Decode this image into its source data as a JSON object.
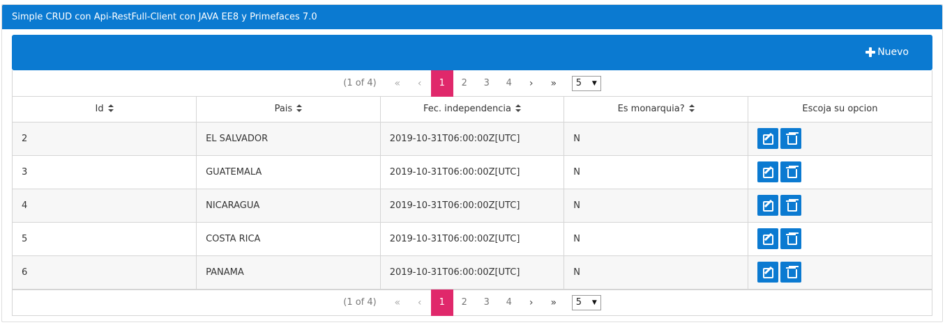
{
  "panel": {
    "title": "Simple CRUD con Api-RestFull-Client con JAVA EE8 y Primefaces 7.0"
  },
  "toolbar": {
    "new_label": "Nuevo"
  },
  "paginator": {
    "current_report": "(1 of 4)",
    "first": "«",
    "prev": "‹",
    "pages": [
      "1",
      "2",
      "3",
      "4"
    ],
    "selected_page": "1",
    "next": "›",
    "last": "»",
    "rows_per_page": "5"
  },
  "table": {
    "columns": [
      "Id",
      "Pais",
      "Fec. independencia",
      "Es monarquia?",
      "Escoja su opcion"
    ],
    "rows": [
      {
        "id": "2",
        "pais": "EL SALVADOR",
        "fecha": "2019-10-31T06:00:00Z[UTC]",
        "monarquia": "N"
      },
      {
        "id": "3",
        "pais": "GUATEMALA",
        "fecha": "2019-10-31T06:00:00Z[UTC]",
        "monarquia": "N"
      },
      {
        "id": "4",
        "pais": "NICARAGUA",
        "fecha": "2019-10-31T06:00:00Z[UTC]",
        "monarquia": "N"
      },
      {
        "id": "5",
        "pais": "COSTA RICA",
        "fecha": "2019-10-31T06:00:00Z[UTC]",
        "monarquia": "N"
      },
      {
        "id": "6",
        "pais": "PANAMA",
        "fecha": "2019-10-31T06:00:00Z[UTC]",
        "monarquia": "N"
      }
    ]
  },
  "colors": {
    "primary": "#0b7ad1",
    "page_selected": "#e0286b",
    "row_odd": "#f7f7f7",
    "border": "#d5d5d5"
  },
  "icons": {
    "new": "plus-icon",
    "edit": "edit-icon",
    "delete": "trash-icon",
    "sort": "sort-icon"
  }
}
